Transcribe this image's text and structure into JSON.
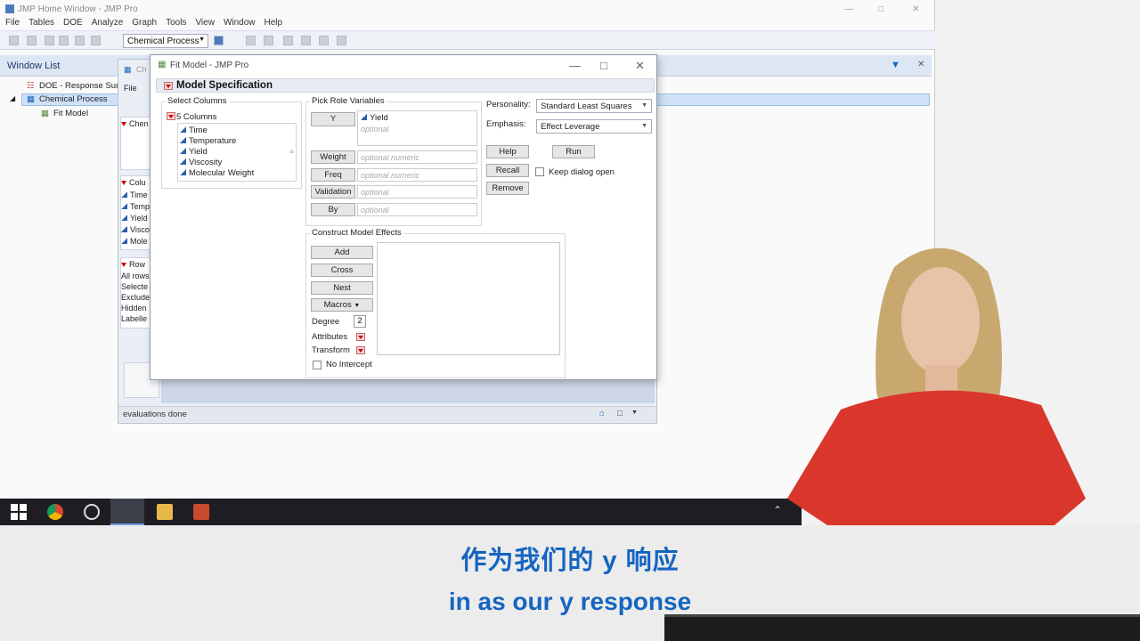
{
  "home_window": {
    "title": "JMP Home Window - JMP Pro",
    "menu": [
      "File",
      "Tables",
      "DOE",
      "Analyze",
      "Graph",
      "Tools",
      "View",
      "Window",
      "Help"
    ],
    "toolbar_table": "Chemical Process",
    "window_list_title": "Window List",
    "tree": [
      "DOE - Response Surf",
      "Chemical Process",
      "Fit Model"
    ]
  },
  "chem_window": {
    "title_partial": "Ch",
    "menu_partial": "File",
    "panel_chem": "Chen",
    "panel_cols": "Colu",
    "cols": [
      "Time",
      "Temp",
      "Yield",
      "Visco",
      "Mole"
    ],
    "panel_rows": "Row",
    "rows": [
      "All rows",
      "Selecte",
      "Exclude",
      "Hidden",
      "Labelle"
    ],
    "status": "evaluations done"
  },
  "dialog": {
    "title": "Fit Model - JMP Pro",
    "header": "Model Specification",
    "select_columns_label": "Select Columns",
    "columns_count": "5 Columns",
    "columns": [
      "Time",
      "Temperature",
      "Yield",
      "Viscosity",
      "Molecular Weight"
    ],
    "pick_role_label": "Pick Role Variables",
    "roles": {
      "y": {
        "label": "Y",
        "value": "Yield",
        "placeholder": "optional"
      },
      "weight": {
        "label": "Weight",
        "placeholder": "optional numeric"
      },
      "freq": {
        "label": "Freq",
        "placeholder": "optional numeric"
      },
      "validation": {
        "label": "Validation",
        "placeholder": "optional"
      },
      "by": {
        "label": "By",
        "placeholder": "optional"
      }
    },
    "personality_label": "Personality:",
    "personality_value": "Standard Least Squares",
    "emphasis_label": "Emphasis:",
    "emphasis_value": "Effect Leverage",
    "help": "Help",
    "run": "Run",
    "recall": "Recall",
    "keep_open": "Keep dialog open",
    "remove": "Remove",
    "construct_label": "Construct Model Effects",
    "add": "Add",
    "cross": "Cross",
    "nest": "Nest",
    "macros": "Macros",
    "degree_label": "Degree",
    "degree_value": "2",
    "attributes": "Attributes",
    "transform": "Transform",
    "no_intercept": "No Intercept"
  },
  "subtitles": {
    "zh": "作为我们的 y 响应",
    "en": "in as our y response"
  },
  "colors": {
    "accent": "#1565c0",
    "selection": "#cfe1f7",
    "red_triangle": "#cc0000"
  }
}
